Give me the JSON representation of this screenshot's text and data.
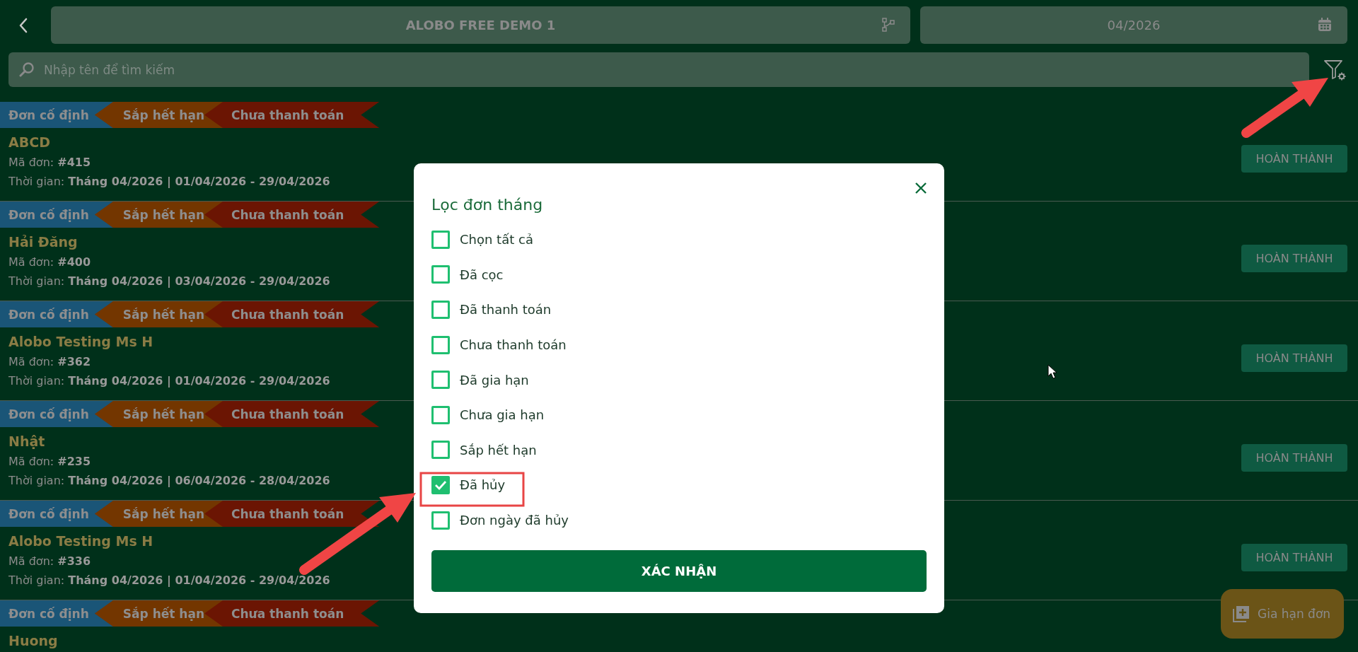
{
  "header": {
    "project": "ALOBO FREE DEMO 1",
    "month": "04/2026"
  },
  "search": {
    "placeholder": "Nhập tên để tìm kiếm"
  },
  "orders": [
    {
      "tags": [
        {
          "label": "Đơn cố định",
          "color": "#1a5577"
        },
        {
          "label": "Sắp hết hạn",
          "color": "#733600"
        },
        {
          "label": "Chưa thanh toán",
          "color": "#6b1503"
        }
      ],
      "name": "ABCD",
      "code": "Mã đơn: **#415**",
      "time": "Thời gian: **Tháng 04/2026 | 01/04/2026 - 29/04/2026**",
      "button": "HOÀN THÀNH"
    },
    {
      "tags": [
        {
          "label": "Đơn cố định",
          "color": "#1a5577"
        },
        {
          "label": "Sắp hết hạn",
          "color": "#733600"
        },
        {
          "label": "Chưa thanh toán",
          "color": "#6b1503"
        }
      ],
      "name": "Hải Đăng",
      "code": "Mã đơn: **#400**",
      "time": "Thời gian: **Tháng 04/2026 | 03/04/2026 - 29/04/2026**",
      "button": "HOÀN THÀNH"
    },
    {
      "tags": [
        {
          "label": "Đơn cố định",
          "color": "#1a5577"
        },
        {
          "label": "Sắp hết hạn",
          "color": "#733600"
        },
        {
          "label": "Chưa thanh toán",
          "color": "#6b1503"
        }
      ],
      "name": "Alobo Testing Ms H",
      "code": "Mã đơn: **#362**",
      "time": "Thời gian: **Tháng 04/2026 | 01/04/2026 - 29/04/2026**",
      "button": "HOÀN THÀNH"
    },
    {
      "tags": [
        {
          "label": "Đơn cố định",
          "color": "#1a5577"
        },
        {
          "label": "Sắp hết hạn",
          "color": "#733600"
        },
        {
          "label": "Chưa thanh toán",
          "color": "#6b1503"
        }
      ],
      "name": "Nhật",
      "code": "Mã đơn: **#235**",
      "time": "Thời gian: **Tháng 04/2026 | 06/04/2026 - 28/04/2026**",
      "button": "HOÀN THÀNH"
    },
    {
      "tags": [
        {
          "label": "Đơn cố định",
          "color": "#1a5577"
        },
        {
          "label": "Sắp hết hạn",
          "color": "#733600"
        },
        {
          "label": "Chưa thanh toán",
          "color": "#6b1503"
        }
      ],
      "name": "Alobo Testing Ms H",
      "code": "Mã đơn: **#336**",
      "time": "Thời gian: **Tháng 04/2026 | 01/04/2026 - 29/04/2026**",
      "button": "HOÀN THÀNH"
    },
    {
      "tags": [
        {
          "label": "Đơn cố định",
          "color": "#1a5577"
        },
        {
          "label": "Sắp hết hạn",
          "color": "#733600"
        },
        {
          "label": "Chưa thanh toán",
          "color": "#6b1503"
        }
      ],
      "name": "Huong"
    }
  ],
  "fab": {
    "label": "Gia hạn đơn"
  },
  "dialog": {
    "title": "Lọc đơn tháng",
    "options": [
      {
        "label": "Chọn tất cả",
        "checked": false
      },
      {
        "label": "Đã cọc",
        "checked": false
      },
      {
        "label": "Đã thanh toán",
        "checked": false
      },
      {
        "label": "Chưa thanh toán",
        "checked": false
      },
      {
        "label": "Đã gia hạn",
        "checked": false
      },
      {
        "label": "Chưa gia hạn",
        "checked": false
      },
      {
        "label": "Sắp hết hạn",
        "checked": false
      },
      {
        "label": "Đã hủy",
        "checked": true
      },
      {
        "label": "Đơn ngày đã hủy",
        "checked": false
      }
    ],
    "confirm": "XÁC NHẬN"
  }
}
